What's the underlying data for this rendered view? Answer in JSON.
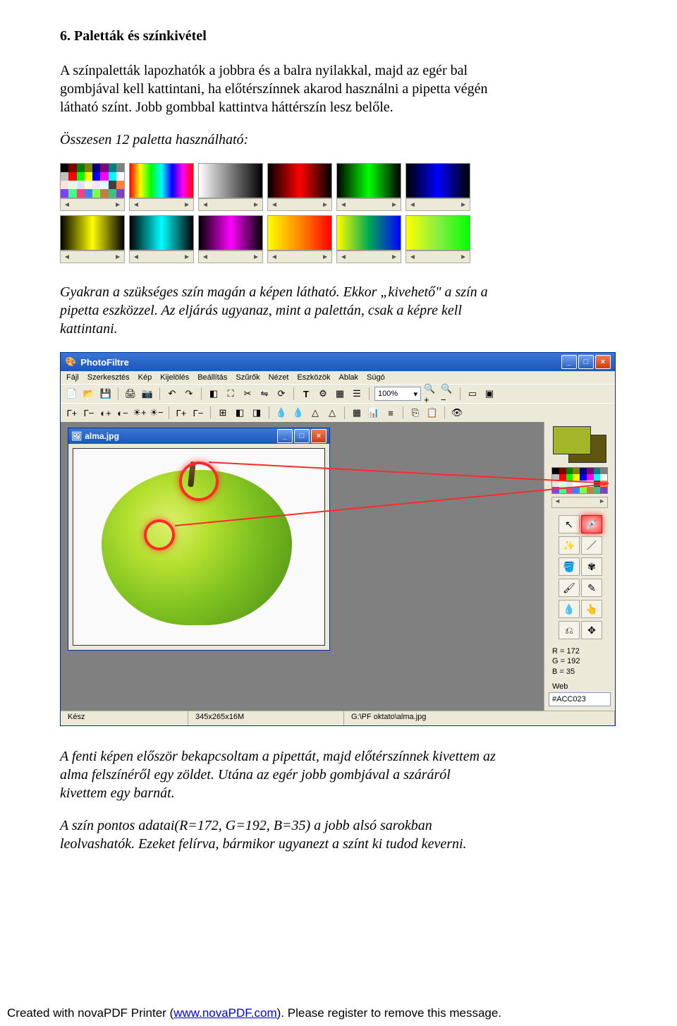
{
  "heading": "6. Paletták és színkivétel",
  "p1": "A színpaletták lapozhatók a jobbra és a balra nyilakkal, majd az egér bal gombjával kell kattintani, ha előtérszínnek akarod használni a pipetta végén látható színt. Jobb gombbal kattintva háttérszín lesz belőle.",
  "p2": "Összesen 12 paletta használható:",
  "p3": "Gyakran a szükséges szín magán a képen látható. Ekkor „kivehető\" a szín a pipetta eszközzel. Az eljárás ugyanaz, mint a palettán, csak a képre kell kattintani.",
  "p4": "A fenti képen először bekapcsoltam a pipettát, majd előtérszínnek kivettem az alma felszínéről egy zöldet. Utána az egér jobb gombjával a száráról kivettem egy barnát.",
  "p5": "A szín pontos adatai(R=172, G=192, B=35) a jobb alsó sarokban leolvashatók. Ezeket felírva, bármikor ugyanezt a színt ki tudod keverni.",
  "app": {
    "title": "PhotoFiltre",
    "menus": [
      "Fájl",
      "Szerkesztés",
      "Kép",
      "Kijelölés",
      "Beállítás",
      "Szűrők",
      "Nézet",
      "Eszközök",
      "Ablak",
      "Súgó"
    ],
    "zoom": "100%",
    "doc_title": "alma.jpg",
    "status_ready": "Kész",
    "status_dims": "345x265x16M",
    "status_path": "G:\\PF oktato\\alma.jpg",
    "rgb_r": "R = 172",
    "rgb_g": "G = 192",
    "rgb_b": "B = 35",
    "web_label": "Web",
    "web_value": "#ACC023"
  },
  "footer": {
    "prefix": "Created with novaPDF Printer (",
    "link": "www.novaPDF.com",
    "suffix": "). Please register to remove this message."
  }
}
